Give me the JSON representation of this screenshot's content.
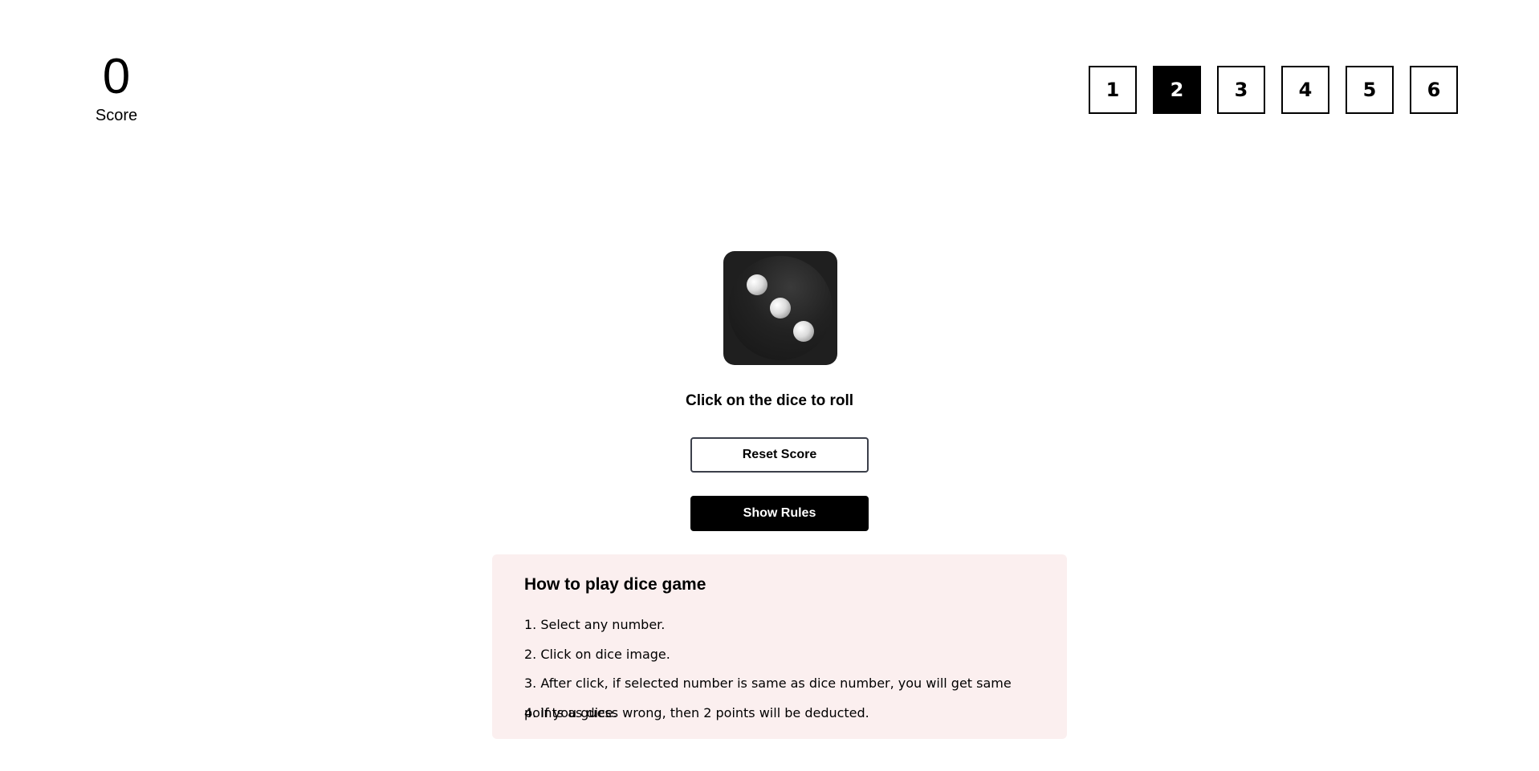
{
  "score": {
    "value": "0",
    "label": "Score"
  },
  "number_selector": {
    "options": [
      "1",
      "2",
      "3",
      "4",
      "5",
      "6"
    ],
    "selected": "2"
  },
  "dice": {
    "current_face": 3,
    "icon": "dice-three-icon"
  },
  "roll_hint": "Click on the dice to roll",
  "buttons": {
    "reset_label": "Reset Score",
    "rules_label": "Show Rules"
  },
  "rules": {
    "title": "How to play dice game",
    "items": [
      "1. Select any number.",
      "2. Click on dice image.",
      "3. After click, if selected number is same as dice number, you will get same points as dice.",
      "4. If you guess wrong, then 2 points will be deducted."
    ]
  },
  "colors": {
    "selected_bg": "#000000",
    "rules_bg": "#fbefef",
    "dice_body": "#1f1f1f"
  }
}
